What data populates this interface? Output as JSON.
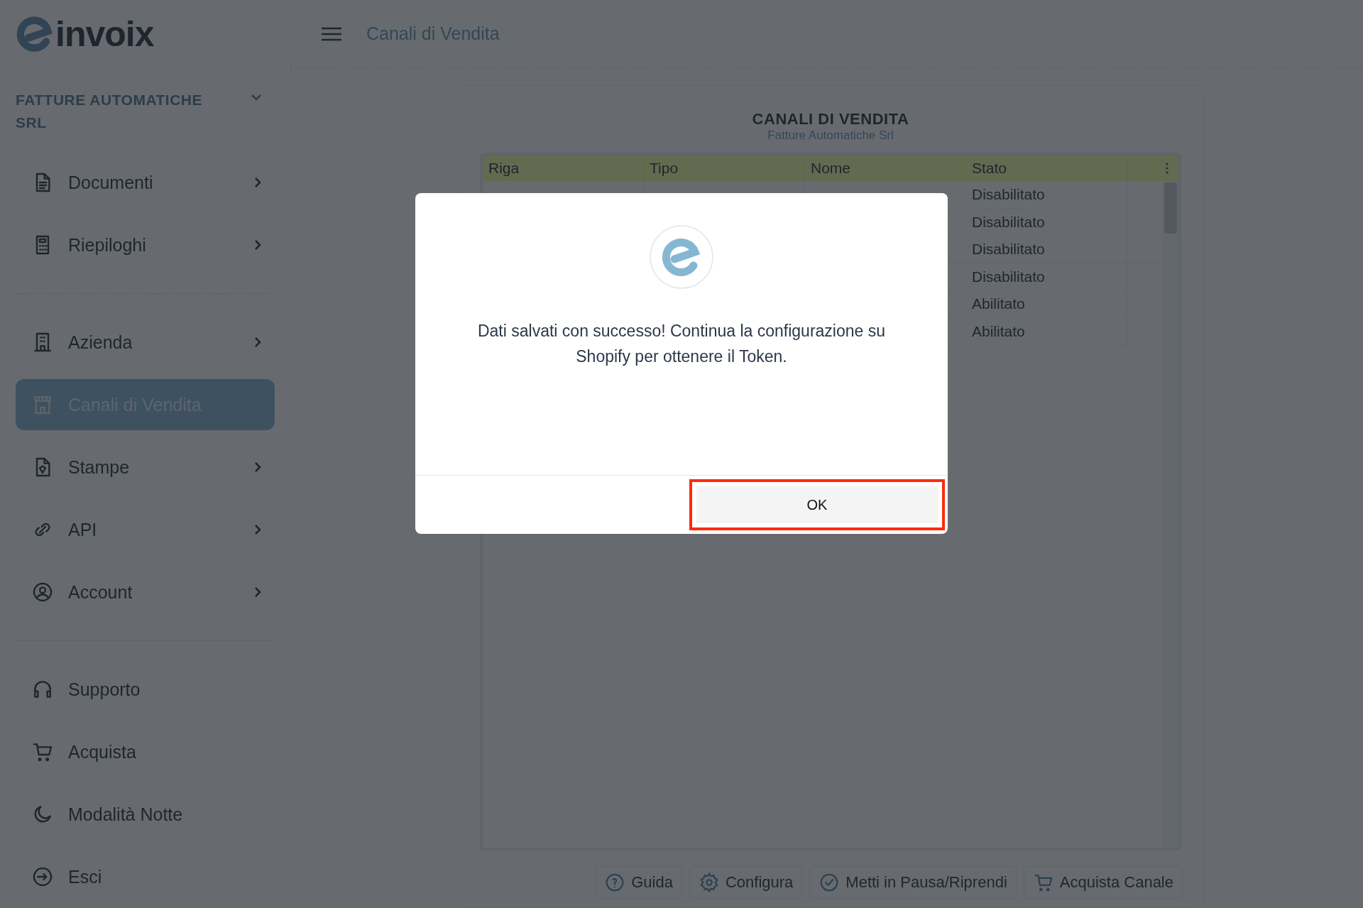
{
  "logo": {
    "text": "invoix"
  },
  "header": {
    "title": "Canali di Vendita"
  },
  "sidebar": {
    "company": "FATTURE AUTOMATICHE SRL",
    "sections": [
      {
        "items": [
          {
            "label": "Documenti",
            "selected": false,
            "expandable": true
          },
          {
            "label": "Riepiloghi",
            "selected": false,
            "expandable": true
          }
        ]
      },
      {
        "items": [
          {
            "label": "Azienda",
            "selected": false,
            "expandable": true
          },
          {
            "label": "Canali di Vendita",
            "selected": true,
            "expandable": false
          },
          {
            "label": "Stampe",
            "selected": false,
            "expandable": true
          },
          {
            "label": "API",
            "selected": false,
            "expandable": true
          },
          {
            "label": "Account",
            "selected": false,
            "expandable": true
          }
        ]
      },
      {
        "items": [
          {
            "label": "Supporto",
            "selected": false,
            "expandable": false
          },
          {
            "label": "Acquista",
            "selected": false,
            "expandable": false
          },
          {
            "label": "Modalità Notte",
            "selected": false,
            "expandable": false
          },
          {
            "label": "Esci",
            "selected": false,
            "expandable": false
          }
        ]
      }
    ]
  },
  "card": {
    "title": "CANALI DI VENDITA",
    "subtitle": "Fatture Automatiche Srl"
  },
  "table": {
    "columns": [
      "Riga",
      "Tipo",
      "Nome",
      "Stato"
    ],
    "rows": [
      {
        "stato": "Disabilitato"
      },
      {
        "stato": "Disabilitato"
      },
      {
        "stato": "Disabilitato"
      },
      {
        "stato": "Disabilitato"
      },
      {
        "stato": "Abilitato"
      },
      {
        "stato": "Abilitato"
      }
    ]
  },
  "buttons": [
    "Guida",
    "Configura",
    "Metti in Pausa/Riprendi",
    "Acquista Canale"
  ],
  "dialog": {
    "message": "Dati salvati con successo! Continua la configurazione su Shopify per ottenere il Token.",
    "button": "OK"
  }
}
